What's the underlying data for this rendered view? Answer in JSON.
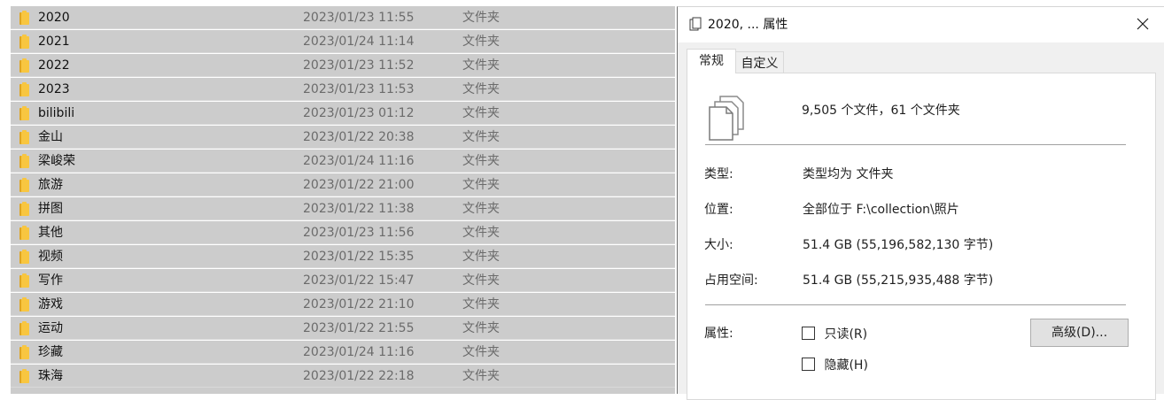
{
  "explorer": {
    "rows": [
      {
        "name": "2020",
        "date": "2023/01/23 11:55",
        "type": "文件夹"
      },
      {
        "name": "2021",
        "date": "2023/01/24 11:14",
        "type": "文件夹"
      },
      {
        "name": "2022",
        "date": "2023/01/23 11:52",
        "type": "文件夹"
      },
      {
        "name": "2023",
        "date": "2023/01/23 11:53",
        "type": "文件夹"
      },
      {
        "name": "bilibili",
        "date": "2023/01/23 01:12",
        "type": "文件夹"
      },
      {
        "name": "金山",
        "date": "2023/01/22 20:38",
        "type": "文件夹"
      },
      {
        "name": "梁峻荣",
        "date": "2023/01/24 11:16",
        "type": "文件夹"
      },
      {
        "name": "旅游",
        "date": "2023/01/22 21:00",
        "type": "文件夹"
      },
      {
        "name": "拼图",
        "date": "2023/01/22 11:38",
        "type": "文件夹"
      },
      {
        "name": "其他",
        "date": "2023/01/23 11:56",
        "type": "文件夹"
      },
      {
        "name": "视频",
        "date": "2023/01/22 15:35",
        "type": "文件夹"
      },
      {
        "name": "写作",
        "date": "2023/01/22 15:47",
        "type": "文件夹"
      },
      {
        "name": "游戏",
        "date": "2023/01/22 21:10",
        "type": "文件夹"
      },
      {
        "name": "运动",
        "date": "2023/01/22 21:55",
        "type": "文件夹"
      },
      {
        "name": "珍藏",
        "date": "2023/01/24 11:16",
        "type": "文件夹"
      },
      {
        "name": "珠海",
        "date": "2023/01/22 22:18",
        "type": "文件夹"
      }
    ],
    "icons": {
      "folder": "folder-icon"
    },
    "colors": {
      "selected_row": "#cccccc",
      "folder_yellow": "#f8c640"
    }
  },
  "dialog": {
    "title": "2020, ... 属性",
    "close_icon": "close-icon",
    "tabs": [
      "常规",
      "自定义"
    ],
    "summary": "9,505 个文件，61 个文件夹",
    "properties": {
      "type_label": "类型:",
      "type_value": "类型均为 文件夹",
      "location_label": "位置:",
      "location_value": "全部位于 F:\\collection\\照片",
      "size_label": "大小:",
      "size_value": "51.4 GB (55,196,582,130 字节)",
      "size_on_disk_label": "占用空间:",
      "size_on_disk_value": "51.4 GB (55,215,935,488 字节)",
      "attributes_label": "属性:"
    },
    "checkboxes": {
      "readonly": "只读(R)",
      "hidden": "隐藏(H)"
    },
    "advanced_button": "高级(D)...",
    "icons": {
      "title": "properties-document-icon",
      "files": "stacked-documents-icon"
    }
  }
}
